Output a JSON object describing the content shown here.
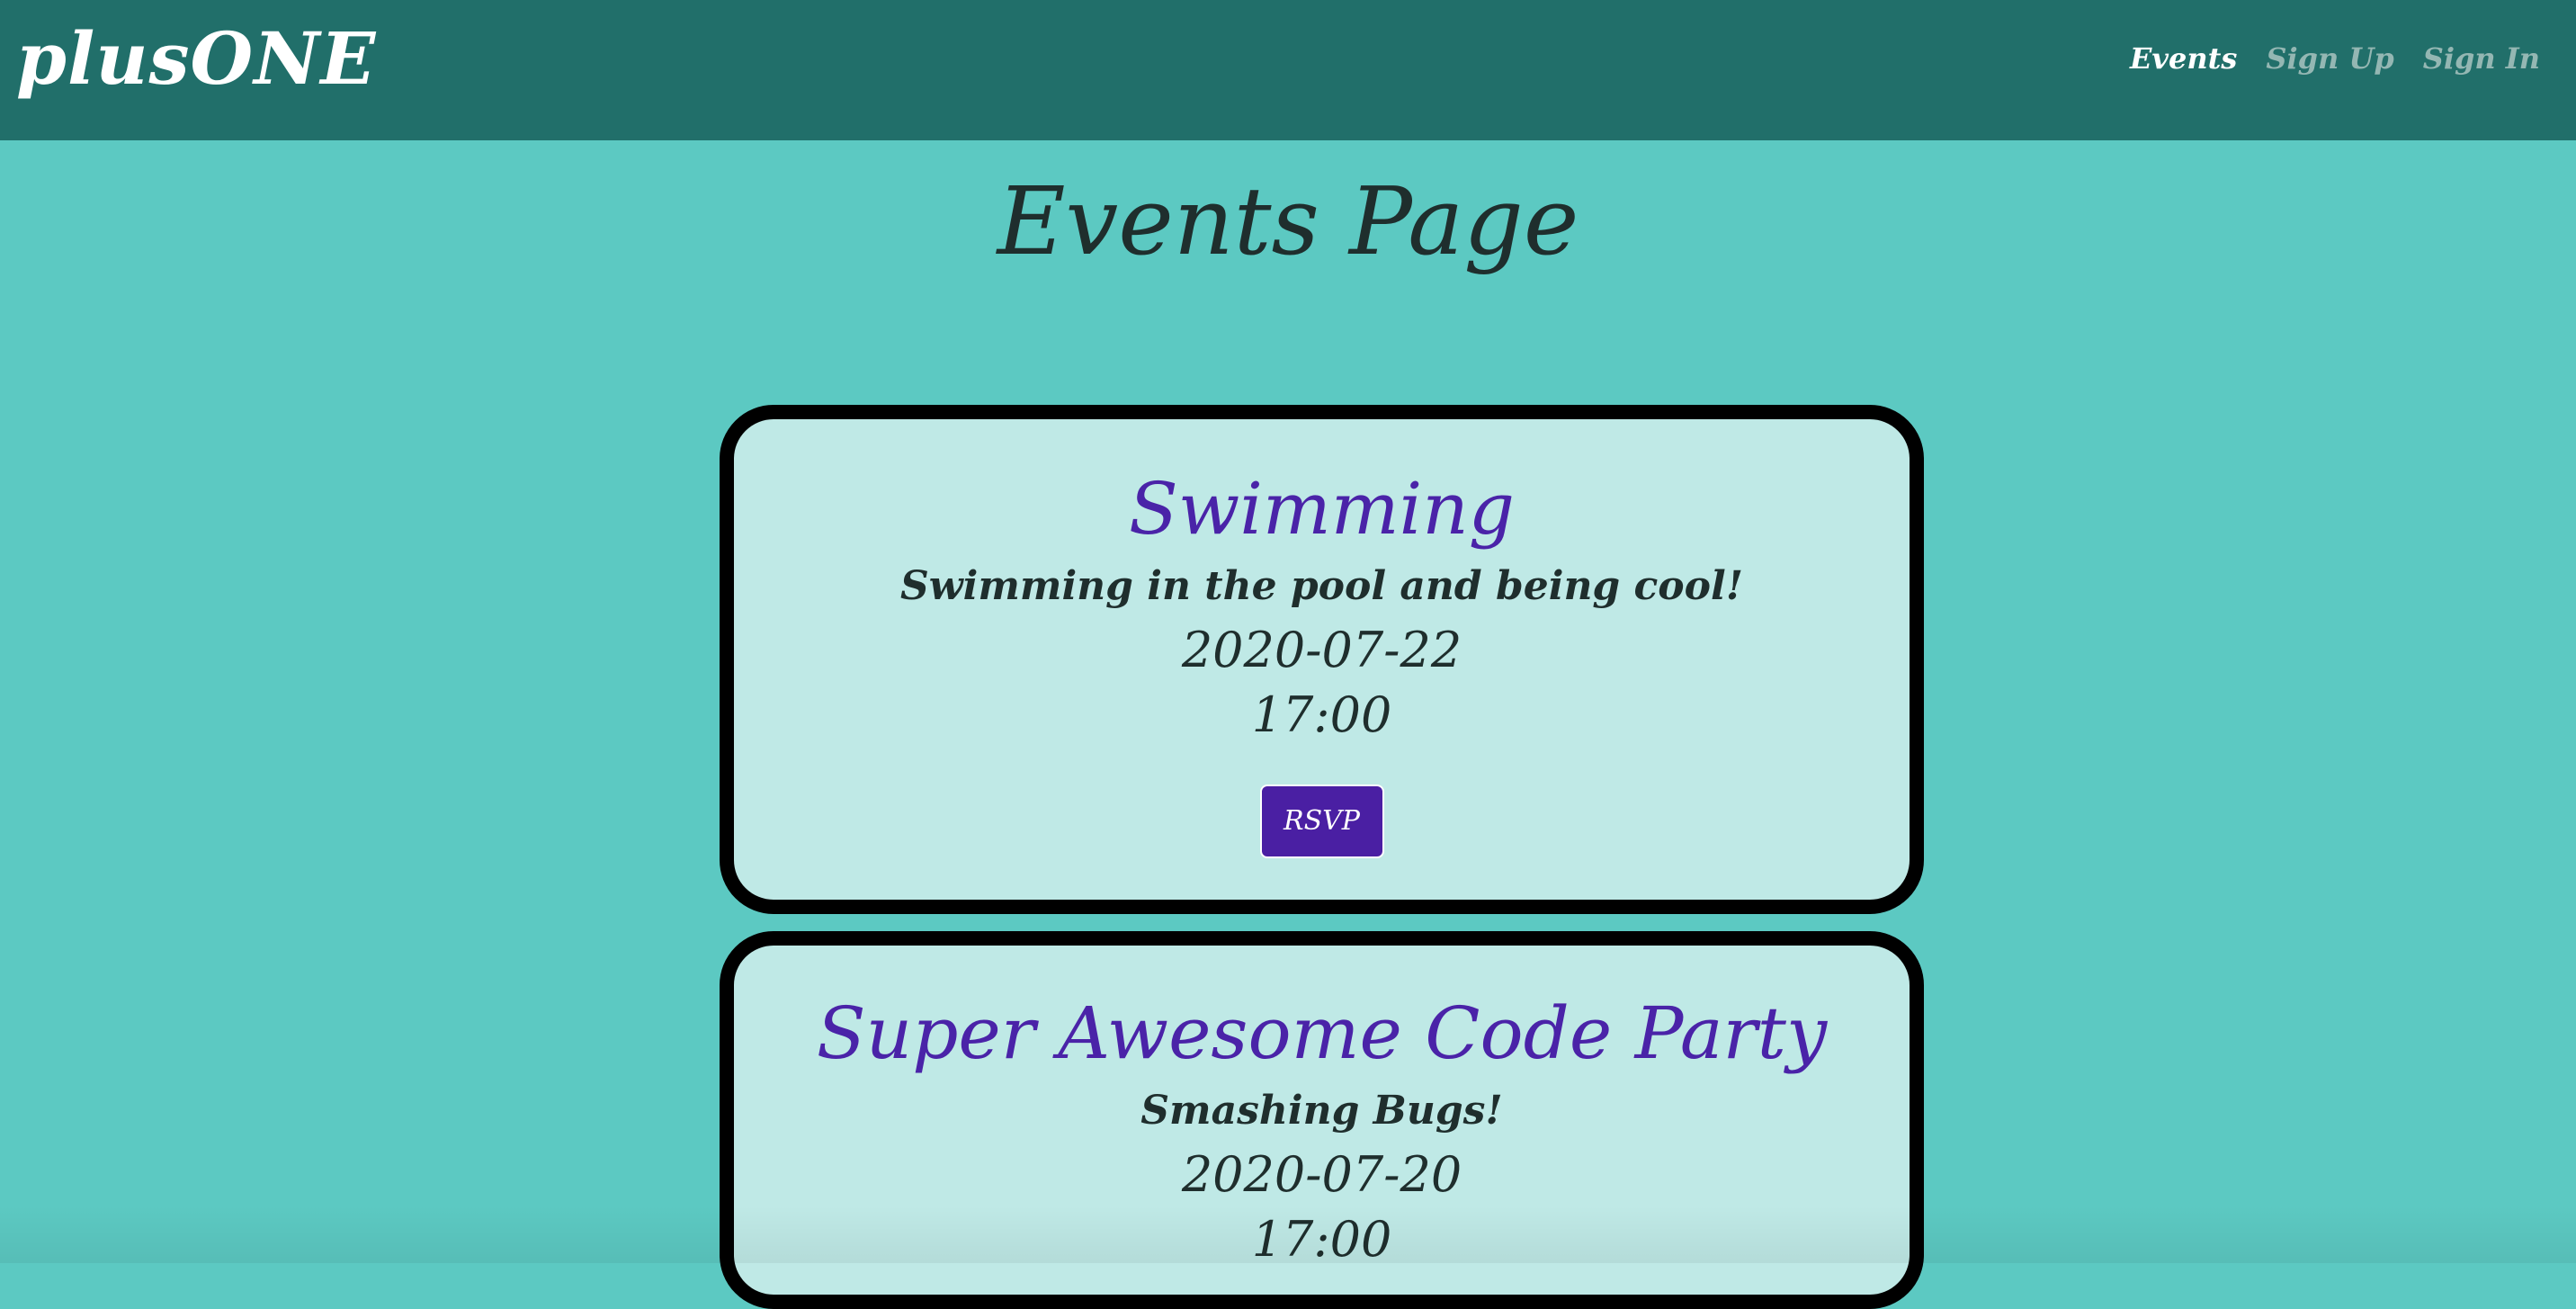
{
  "header": {
    "brand": "plusONE",
    "nav": [
      {
        "label": "Events",
        "active": true
      },
      {
        "label": "Sign Up",
        "active": false
      },
      {
        "label": "Sign In",
        "active": false
      }
    ]
  },
  "page": {
    "title": "Events Page"
  },
  "events": [
    {
      "title": "Swimming",
      "description": "Swimming in the pool and being cool!",
      "date": "2020-07-22",
      "time": "17:00",
      "button_label": "RSVP"
    },
    {
      "title": "Super Awesome Code Party",
      "description": "Smashing Bugs!",
      "date": "2020-07-20",
      "time": "17:00"
    }
  ],
  "colors": {
    "navbar": "#216f6a",
    "background": "#5cc9c2",
    "card": "#bfe9e6",
    "card_border": "#000000",
    "title_accent": "#4a23a8",
    "button": "#4a1fa3",
    "nav_active": "#ffffff",
    "nav_inactive": "#94b7b3"
  }
}
